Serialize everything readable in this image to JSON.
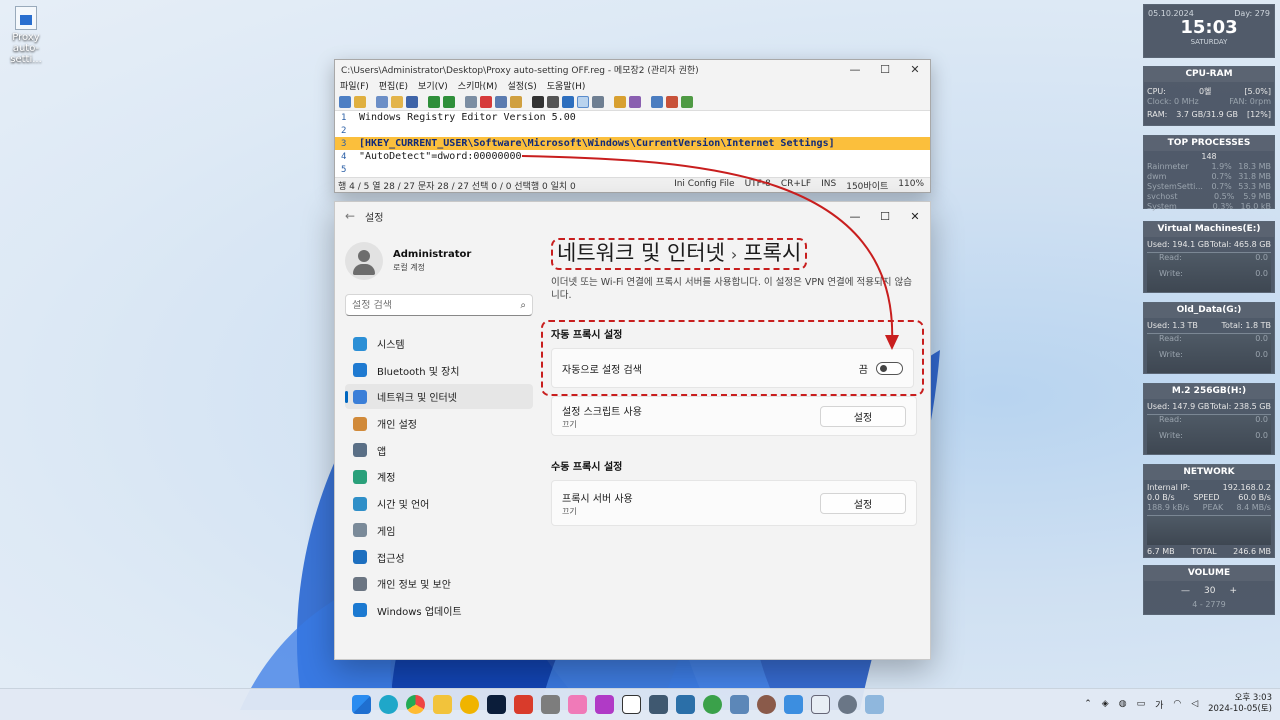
{
  "desktop": {
    "icon_label": "Proxy\nauto-setti..."
  },
  "notepad": {
    "title": "C:\\Users\\Administrator\\Desktop\\Proxy auto-setting OFF.reg - 메모장2 (관리자 권한)",
    "menu": [
      "파일(F)",
      "편집(E)",
      "보기(V)",
      "스키마(M)",
      "설정(S)",
      "도움말(H)"
    ],
    "lines": [
      {
        "num": "1",
        "text": "Windows Registry Editor Version 5.00"
      },
      {
        "num": "2",
        "text": ""
      },
      {
        "num": "3",
        "text": "[HKEY_CURRENT_USER\\Software\\Microsoft\\Windows\\CurrentVersion\\Internet Settings]"
      },
      {
        "num": "4",
        "text": "\"AutoDetect\"=dword:00000000"
      },
      {
        "num": "5",
        "text": ""
      }
    ],
    "status_left": "행 4 / 5  열 28 / 27  문자 28 / 27  선택 0 / 0  선택행 0  일치 0",
    "status_right": [
      "Ini Config File",
      "UTF-8",
      "CR+LF",
      "INS",
      "150바이트",
      "110%"
    ]
  },
  "settings": {
    "window_title": "설정",
    "user": {
      "name": "Administrator",
      "sub": "로컬 계정"
    },
    "search_placeholder": "설정 검색",
    "nav": [
      {
        "label": "시스템",
        "color": "#2b8fd6"
      },
      {
        "label": "Bluetooth 및 장치",
        "color": "#1f7ad1"
      },
      {
        "label": "네트워크 및 인터넷",
        "color": "#3b7fd8"
      },
      {
        "label": "개인 설정",
        "color": "#d18a3a"
      },
      {
        "label": "앱",
        "color": "#5a6f86"
      },
      {
        "label": "계정",
        "color": "#2aa07a"
      },
      {
        "label": "시간 및 언어",
        "color": "#2f8fc8"
      },
      {
        "label": "게임",
        "color": "#7a8a99"
      },
      {
        "label": "접근성",
        "color": "#1d6fbf"
      },
      {
        "label": "개인 정보 및 보안",
        "color": "#6b7582"
      },
      {
        "label": "Windows 업데이트",
        "color": "#1b79d1"
      }
    ],
    "breadcrumb": {
      "parent": "네트워크 및 인터넷",
      "sep": "›",
      "current": "프록시"
    },
    "description": "이더넷 또는 Wi-Fi 연결에 프록시 서버를 사용합니다. 이 설정은 VPN 연결에 적용되지 않습니다.",
    "auto_section": "자동 프록시 설정",
    "auto_detect": {
      "label": "자동으로 설정 검색",
      "state": "끔"
    },
    "script": {
      "label": "설정 스크립트 사용",
      "sub": "끄기",
      "button": "설정"
    },
    "manual_section": "수동 프록시 설정",
    "proxy_server": {
      "label": "프록시 서버 사용",
      "sub": "끄기",
      "button": "설정"
    }
  },
  "gadgets": {
    "clock": {
      "date": "05.10.2024",
      "day_of_year": "Day: 279",
      "time": "15:03",
      "weekday": "SATURDAY"
    },
    "cpu": {
      "title": "CPU-RAM",
      "cpu_label": "CPU:",
      "cpu_temp": "0혤",
      "cpu_pct": "[5.0%]",
      "clock": "Clock: 0 MHz",
      "fan": "FAN: 0rpm",
      "ram_label": "RAM:",
      "ram_val": "3.7 GB/31.9 GB",
      "ram_pct": "[12%]"
    },
    "procs": {
      "title": "TOP PROCESSES",
      "count": "148",
      "rows": [
        [
          "Rainmeter",
          "1.9%",
          "18.3 MB"
        ],
        [
          "dwm",
          "0.7%",
          "31.8 MB"
        ],
        [
          "SystemSetti...",
          "0.7%",
          "53.3 MB"
        ],
        [
          "svchost",
          "0.5%",
          "5.9 MB"
        ],
        [
          "System",
          "0.3%",
          "16.0 kB"
        ]
      ]
    },
    "disks": [
      {
        "title": "Virtual Machines(E:)",
        "used": "Used: 194.1 GB",
        "total": "Total: 465.8 GB"
      },
      {
        "title": "Old_Data(G:)",
        "used": "Used: 1.3 TB",
        "total": "Total: 1.8 TB"
      },
      {
        "title": "M.2 256GB(H:)",
        "used": "Used: 147.9 GB",
        "total": "Total: 238.5 GB"
      }
    ],
    "disk_read": "Read:",
    "disk_write": "Write:",
    "disk_zero": "0.0",
    "net": {
      "title": "NETWORK",
      "ip_label": "Internal IP:",
      "ip": "192.168.0.2",
      "down": "0.0 B/s",
      "speed": "SPEED",
      "speed_val": "60.0 B/s",
      "up": "188.9 kB/s",
      "peak": "PEAK",
      "peak_val": "8.4 MB/s",
      "total_l": "6.7 MB",
      "total": "TOTAL",
      "total_val": "246.6 MB"
    },
    "volume": {
      "title": "VOLUME",
      "value": "30",
      "minus": "—",
      "plus": "+",
      "range": "4 - 2779"
    }
  },
  "taskbar": {
    "time": "오후 3:03",
    "date": "2024-10-05(토)",
    "ime": "가"
  }
}
